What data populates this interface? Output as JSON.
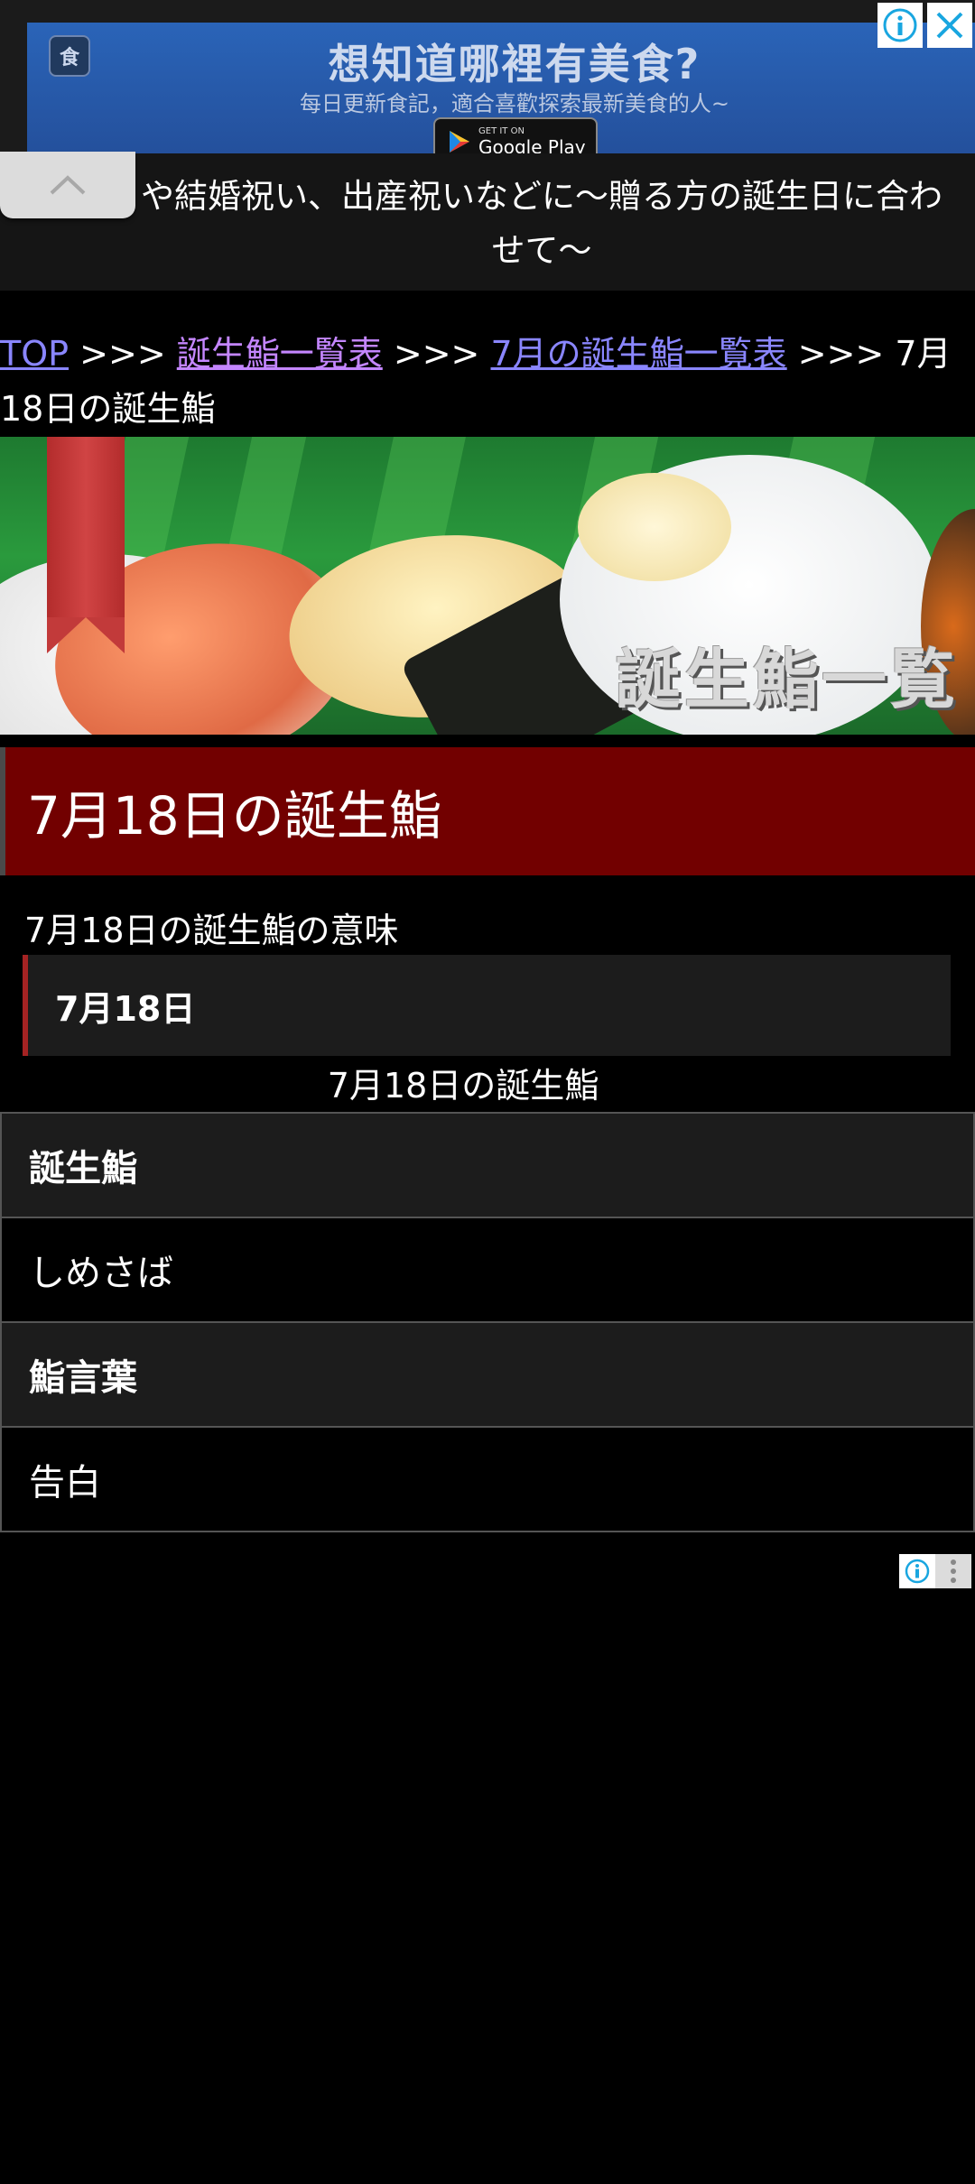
{
  "ad": {
    "title": "想知道哪裡有美食?",
    "subtitle": "每日更新食記，適合喜歡探索最新美食的人~",
    "play_small": "GET IT ON",
    "play_big": "Google Play",
    "logo_text": "食"
  },
  "header": {
    "text": "や結婚祝い、出産祝いなどに〜贈る方の誕生日に合わせて〜"
  },
  "breadcrumb": {
    "top": "TOP",
    "sep": ">>>",
    "list": "誕生鮨一覧表",
    "month": "7月の誕生鮨一覧表",
    "current": "7月18日の誕生鮨"
  },
  "hero": {
    "label": "誕生鮨一覧"
  },
  "page": {
    "title": "7月18日の誕生鮨",
    "meaning": "7月18日の誕生鮨の意味",
    "date": "7月18日",
    "caption": "7月18日の誕生鮨"
  },
  "table": {
    "rows": [
      {
        "label": "誕生鮨",
        "value": "しめさば"
      },
      {
        "label": "鮨言葉",
        "value": "告白"
      }
    ]
  }
}
